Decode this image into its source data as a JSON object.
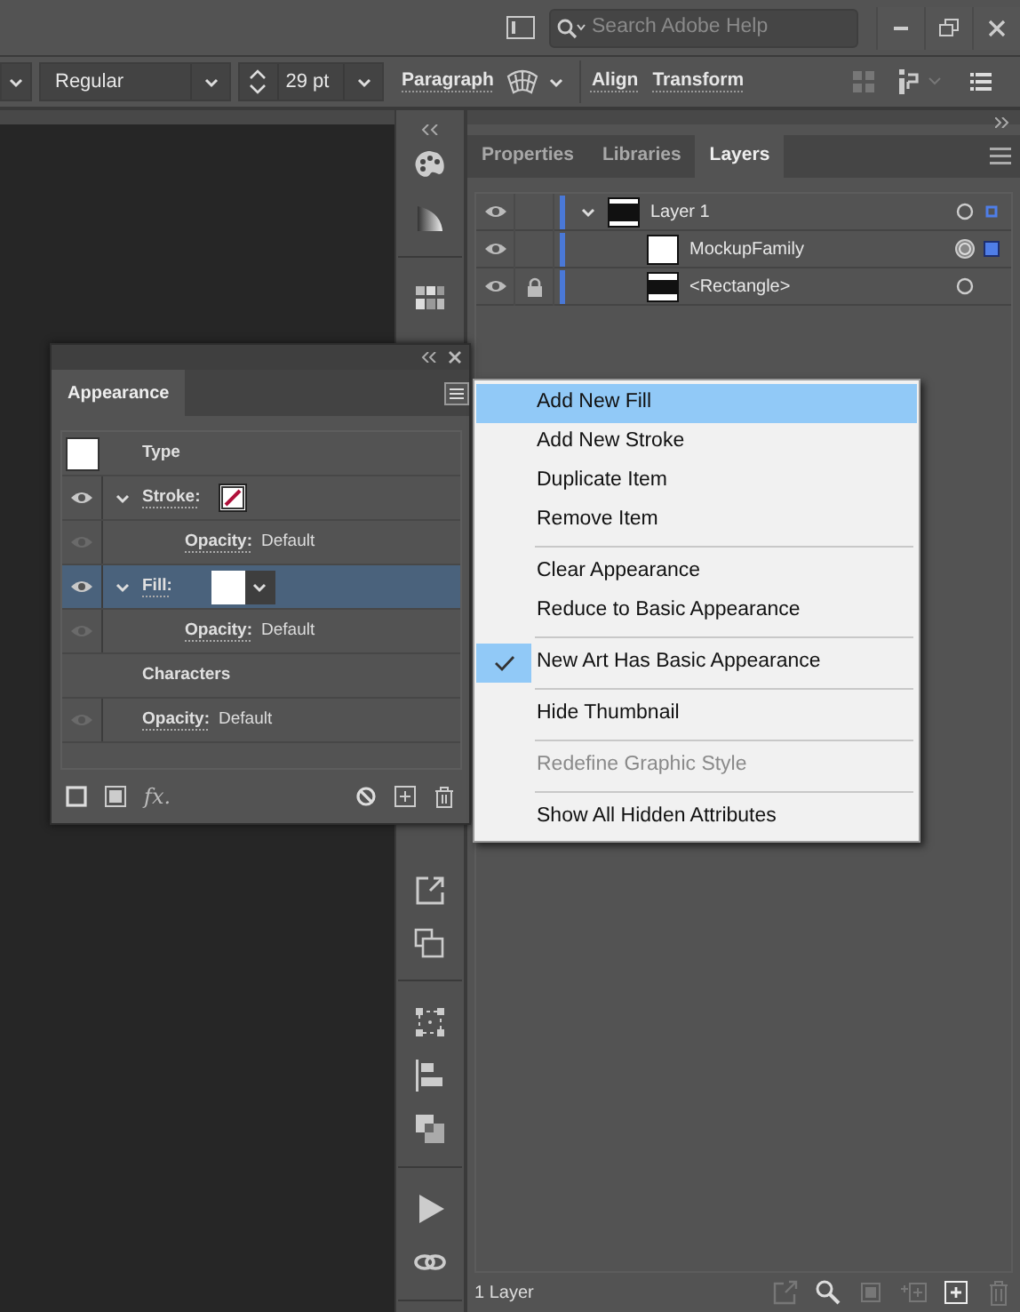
{
  "search": {
    "placeholder": "Search Adobe Help"
  },
  "control_bar": {
    "font_style": "Regular",
    "font_size": "29 pt",
    "links": [
      "Paragraph",
      "Align",
      "Transform"
    ]
  },
  "panel_tabs": [
    {
      "label": "Properties",
      "selected": false
    },
    {
      "label": "Libraries",
      "selected": false
    },
    {
      "label": "Layers",
      "selected": true
    }
  ],
  "layers": [
    {
      "name": "Layer 1",
      "visible": true,
      "locked": false,
      "expanded": true,
      "targeted": false,
      "selected": false,
      "kind": "layer",
      "children": [
        {
          "name": "MockupFamily",
          "visible": true,
          "locked": false,
          "targeted": true,
          "selected": true,
          "kind": "text"
        },
        {
          "name": "<Rectangle>",
          "visible": true,
          "locked": true,
          "targeted": false,
          "selected": false,
          "kind": "rectangle"
        }
      ]
    }
  ],
  "layers_footer": "1 Layer",
  "appearance": {
    "title": "Appearance",
    "fx": "fx.",
    "rows": [
      {
        "kind": "header",
        "label": "Type"
      },
      {
        "kind": "stroke",
        "label": "Stroke:",
        "visible": true,
        "expanded": true,
        "selected": false,
        "children": [
          {
            "kind": "opacity",
            "label": "Opacity:",
            "value": "Default",
            "visible": false
          }
        ]
      },
      {
        "kind": "fill",
        "label": "Fill:",
        "visible": true,
        "expanded": true,
        "selected": true,
        "children": [
          {
            "kind": "opacity",
            "label": "Opacity:",
            "value": "Default",
            "visible": false
          }
        ]
      },
      {
        "kind": "group",
        "label": "Characters"
      },
      {
        "kind": "opacity",
        "label": "Opacity:",
        "value": "Default",
        "visible": false
      }
    ]
  },
  "menu_groups": [
    [
      {
        "label": "Add New Fill",
        "highlighted": true,
        "checked": false,
        "disabled": false
      },
      {
        "label": "Add New Stroke",
        "highlighted": false,
        "checked": false,
        "disabled": false
      },
      {
        "label": "Duplicate Item",
        "highlighted": false,
        "checked": false,
        "disabled": false
      },
      {
        "label": "Remove Item",
        "highlighted": false,
        "checked": false,
        "disabled": false
      }
    ],
    [
      {
        "label": "Clear Appearance",
        "highlighted": false,
        "checked": false,
        "disabled": false
      },
      {
        "label": "Reduce to Basic Appearance",
        "highlighted": false,
        "checked": false,
        "disabled": false
      }
    ],
    [
      {
        "label": "New Art Has Basic Appearance",
        "highlighted": false,
        "checked": true,
        "disabled": false
      }
    ],
    [
      {
        "label": "Hide Thumbnail",
        "highlighted": false,
        "checked": false,
        "disabled": false
      }
    ],
    [
      {
        "label": "Redefine Graphic Style",
        "highlighted": false,
        "checked": false,
        "disabled": true
      }
    ],
    [
      {
        "label": "Show All Hidden Attributes",
        "highlighted": false,
        "checked": false,
        "disabled": false
      }
    ]
  ]
}
